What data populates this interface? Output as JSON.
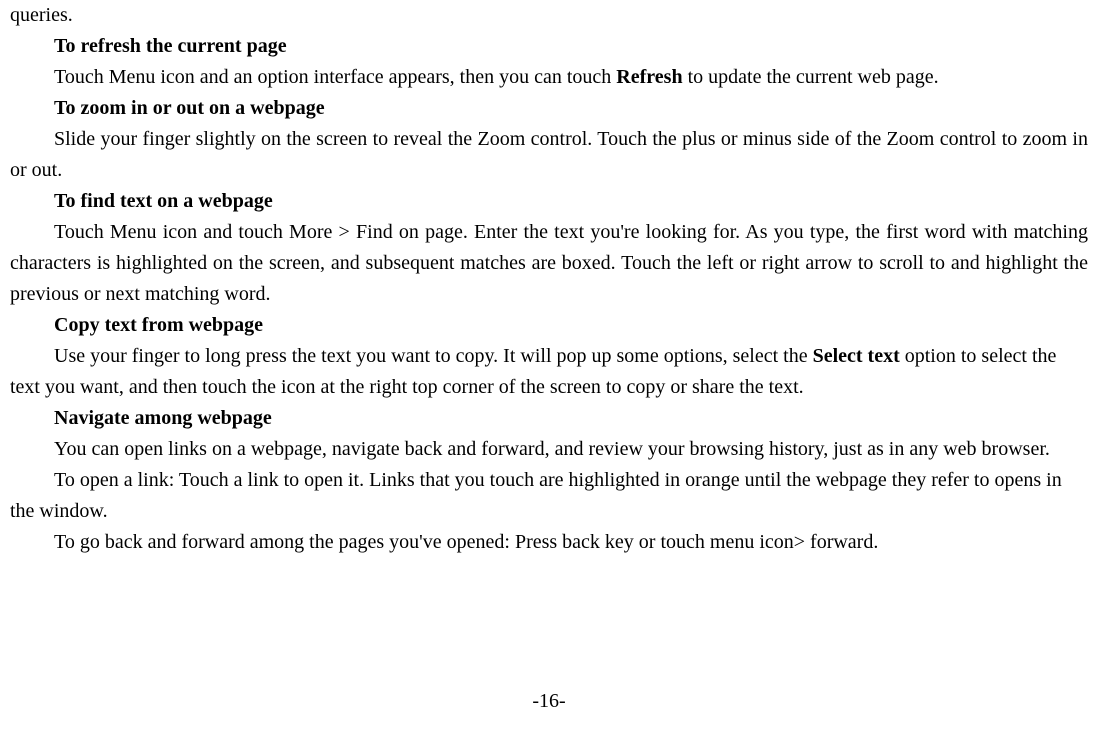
{
  "line1": "queries.",
  "h1": "To refresh the current page",
  "p1a": "Touch Menu icon and an option interface appears, then you can touch ",
  "p1b": "Refresh",
  "p1c": " to update the current web page.",
  "h2": "To zoom in or out on a webpage",
  "p2": "Slide your finger slightly on the screen to reveal the Zoom control. Touch the plus or minus side of the Zoom control to zoom in or out.",
  "h3": "To find text on a webpage",
  "p3": "Touch Menu icon and touch More > Find on page. Enter the text you're looking for. As you type, the first word with matching characters is highlighted on the screen, and subsequent matches are boxed. Touch the left or right arrow to scroll to and highlight the previous or next matching word.",
  "h4": "Copy text from webpage",
  "p4a": "Use your finger to long press the text you want to copy. It will pop up some options, select the ",
  "p4b": "Select text",
  "p4c": " option to select the text you want, and then touch the icon at the right top corner of the screen to copy or share the text.",
  "h5": "Navigate among webpage",
  "p5": "You can open links on a webpage, navigate back and forward, and review your browsing history, just as in any web browser.",
  "p6": "To open a link: Touch a link to open it. Links that you touch are highlighted in orange until the webpage they refer to opens in the window.",
  "p7": "To go back and forward among the pages you've opened: Press back key or touch menu icon> forward.",
  "pagenum": "-16-"
}
